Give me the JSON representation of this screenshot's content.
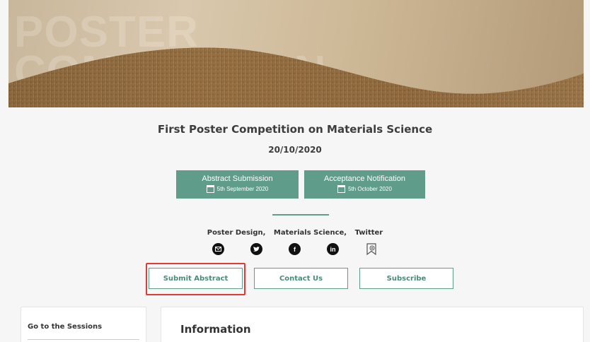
{
  "banner": {
    "text": "POSTER\nCOMPETITION"
  },
  "event": {
    "title": "First Poster Competition on Materials Science",
    "date": "20/10/2020"
  },
  "deadlines": [
    {
      "title": "Abstract Submission",
      "date": "5th September 2020"
    },
    {
      "title": "Acceptance Notification",
      "date": "5th October 2020"
    }
  ],
  "keywords": [
    "Poster Design,",
    "Materials Science,",
    "Twitter"
  ],
  "share_icons": [
    "email-icon",
    "twitter-icon",
    "facebook-icon",
    "linkedin-icon",
    "bookmark-icon"
  ],
  "buttons": {
    "submit": "Submit Abstract",
    "contact": "Contact Us",
    "subscribe": "Subscribe"
  },
  "sidebar": {
    "title": "Go to the Sessions"
  },
  "info": {
    "heading": "Information"
  },
  "colors": {
    "accent": "#5f9c89",
    "highlight": "#e53935"
  }
}
